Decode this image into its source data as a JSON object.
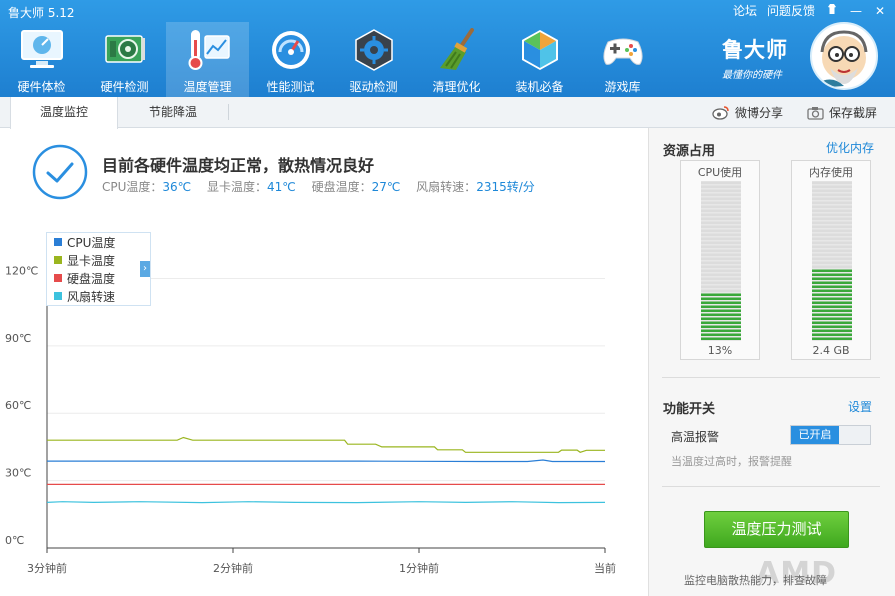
{
  "app": {
    "title": "鲁大师 5.12"
  },
  "top_links": {
    "forum": "论坛",
    "feedback": "问题反馈",
    "skin_icon": "skin-icon",
    "minimize": "—",
    "close": "✕"
  },
  "nav": [
    {
      "label": "硬件体检",
      "icon": "monitor-icon"
    },
    {
      "label": "硬件检测",
      "icon": "graphics-card-icon"
    },
    {
      "label": "温度管理",
      "icon": "thermometer-icon",
      "active": true
    },
    {
      "label": "性能测试",
      "icon": "speedometer-icon"
    },
    {
      "label": "驱动检测",
      "icon": "driver-gear-icon"
    },
    {
      "label": "清理优化",
      "icon": "broom-icon"
    },
    {
      "label": "装机必备",
      "icon": "box-icon"
    },
    {
      "label": "游戏库",
      "icon": "gamepad-icon"
    }
  ],
  "brand": {
    "name": "鲁大师",
    "slogan": "最懂你的硬件"
  },
  "tabs": [
    {
      "label": "温度监控",
      "active": true
    },
    {
      "label": "节能降温"
    }
  ],
  "toolbar": {
    "share_label": "微博分享",
    "screenshot_label": "保存截屏"
  },
  "status": {
    "title": "目前各硬件温度均正常，散热情况良好",
    "cpu_label": "CPU温度：",
    "cpu_value": "36℃",
    "gpu_label": "显卡温度：",
    "gpu_value": "41℃",
    "disk_label": "硬盘温度：",
    "disk_value": "27℃",
    "fan_label": "风扇转速：",
    "fan_value": "2315转/分"
  },
  "legend": [
    {
      "name": "CPU温度",
      "color": "#2a7ed6"
    },
    {
      "name": "显卡温度",
      "color": "#9ab51f"
    },
    {
      "name": "硬盘温度",
      "color": "#e64b4b"
    },
    {
      "name": "风扇转速",
      "color": "#3dc2de"
    }
  ],
  "chart_data": {
    "type": "line",
    "y_tick_labels": [
      "0℃",
      "30℃",
      "60℃",
      "90℃",
      "120℃"
    ],
    "y_ticks": [
      0,
      30,
      60,
      90,
      120
    ],
    "ylim": [
      0,
      130
    ],
    "x_tick_labels": [
      "3分钟前",
      "2分钟前",
      "1分钟前",
      "当前"
    ],
    "x_ticks": [
      0,
      60,
      120,
      180
    ],
    "xlim": [
      0,
      180
    ],
    "grid": true,
    "legend_position": "top-left",
    "series": [
      {
        "name": "CPU温度",
        "color": "#2a7ed6",
        "points": [
          [
            0,
            38.7
          ],
          [
            20,
            38.7
          ],
          [
            40,
            38.7
          ],
          [
            60,
            38.7
          ],
          [
            80,
            38.7
          ],
          [
            100,
            38.7
          ],
          [
            120,
            38.6
          ],
          [
            140,
            38.5
          ],
          [
            155,
            38.5
          ],
          [
            160,
            39.2
          ],
          [
            163,
            38.5
          ],
          [
            180,
            38.5
          ]
        ]
      },
      {
        "name": "显卡温度",
        "color": "#9ab51f",
        "points": [
          [
            0,
            48
          ],
          [
            42,
            48
          ],
          [
            44,
            49.2
          ],
          [
            47,
            48
          ],
          [
            96,
            48
          ],
          [
            97,
            46.2
          ],
          [
            106,
            46.2
          ],
          [
            108,
            45
          ],
          [
            125,
            45
          ],
          [
            126,
            43.7
          ],
          [
            134,
            43.7
          ],
          [
            135,
            42.6
          ],
          [
            165,
            42.6
          ],
          [
            166,
            43.6
          ],
          [
            171,
            43.6
          ],
          [
            172,
            42.6
          ],
          [
            174,
            43.5
          ],
          [
            180,
            43.5
          ]
        ]
      },
      {
        "name": "硬盘温度",
        "color": "#e64b4b",
        "points": [
          [
            0,
            28.3
          ],
          [
            180,
            28.3
          ]
        ]
      },
      {
        "name": "风扇转速",
        "color": "#3dc2de",
        "points": [
          [
            0,
            20.3
          ],
          [
            5,
            20.6
          ],
          [
            15,
            20.3
          ],
          [
            30,
            20.6
          ],
          [
            50,
            20.2
          ],
          [
            65,
            20.6
          ],
          [
            80,
            20.3
          ],
          [
            100,
            20.2
          ],
          [
            120,
            20.6
          ],
          [
            135,
            20.3
          ],
          [
            150,
            20.6
          ],
          [
            165,
            20.2
          ],
          [
            180,
            20.3
          ]
        ]
      }
    ]
  },
  "resources": {
    "title": "资源占用",
    "optimize_link": "优化内存",
    "cpu": {
      "label": "CPU使用",
      "value_text": "13%",
      "fraction": 0.3
    },
    "mem": {
      "label": "内存使用",
      "value_text": "2.4 GB",
      "fraction": 0.44
    }
  },
  "functions": {
    "title": "功能开关",
    "settings_link": "设置",
    "alarm_label": "高温报警",
    "alarm_state": "已开启",
    "alarm_desc": "当温度过高时，报警提醒"
  },
  "stress_test": {
    "button": "温度压力测试",
    "note": "监控电脑散热能力，排查故障"
  },
  "watermark": "AMD"
}
